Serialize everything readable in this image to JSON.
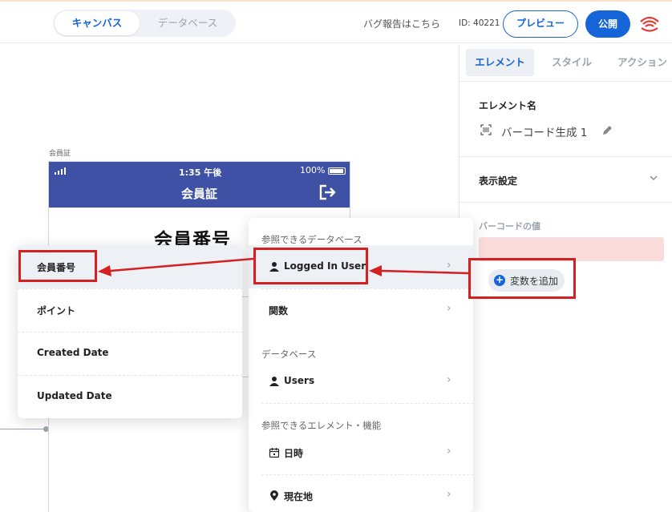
{
  "toolbar": {
    "tab_canvas": "キャンバス",
    "tab_database": "データベース",
    "bug_report": "バグ報告はこちら",
    "app_id": "ID: 40221",
    "preview": "プレビュー",
    "publish": "公開",
    "accent_color": "#1565d8"
  },
  "canvas": {
    "screen_label": "会員証",
    "status": {
      "time": "1:35 午後",
      "battery": "100%"
    },
    "header_title": "会員証",
    "member_number_text": "会員番号",
    "header_color": "#3f51a5"
  },
  "panel": {
    "tabs": [
      "エレメント",
      "スタイル",
      "アクション"
    ],
    "element_name_title": "エレメント名",
    "element_name": "バーコード生成 1",
    "display_settings": "表示設定",
    "barcode_value_label": "バーコードの値",
    "add_variable": "変数を追加"
  },
  "dropdown": {
    "section_ref_db": "参照できるデータベース",
    "logged_in_user": "Logged In User",
    "functions": "関数",
    "section_db": "データベース",
    "users": "Users",
    "section_ref_elements": "参照できるエレメント・機能",
    "datetime": "日時",
    "location": "現在地"
  },
  "submenu": {
    "items": [
      "会員番号",
      "ポイント",
      "Created Date",
      "Updated Date"
    ]
  },
  "icons": {
    "logout": "logout-icon",
    "user": "user-icon",
    "calendar": "calendar-icon",
    "location": "location-pin-icon",
    "barcode": "barcode-icon",
    "pencil": "pencil-icon"
  },
  "annotation_color": "#d42020"
}
